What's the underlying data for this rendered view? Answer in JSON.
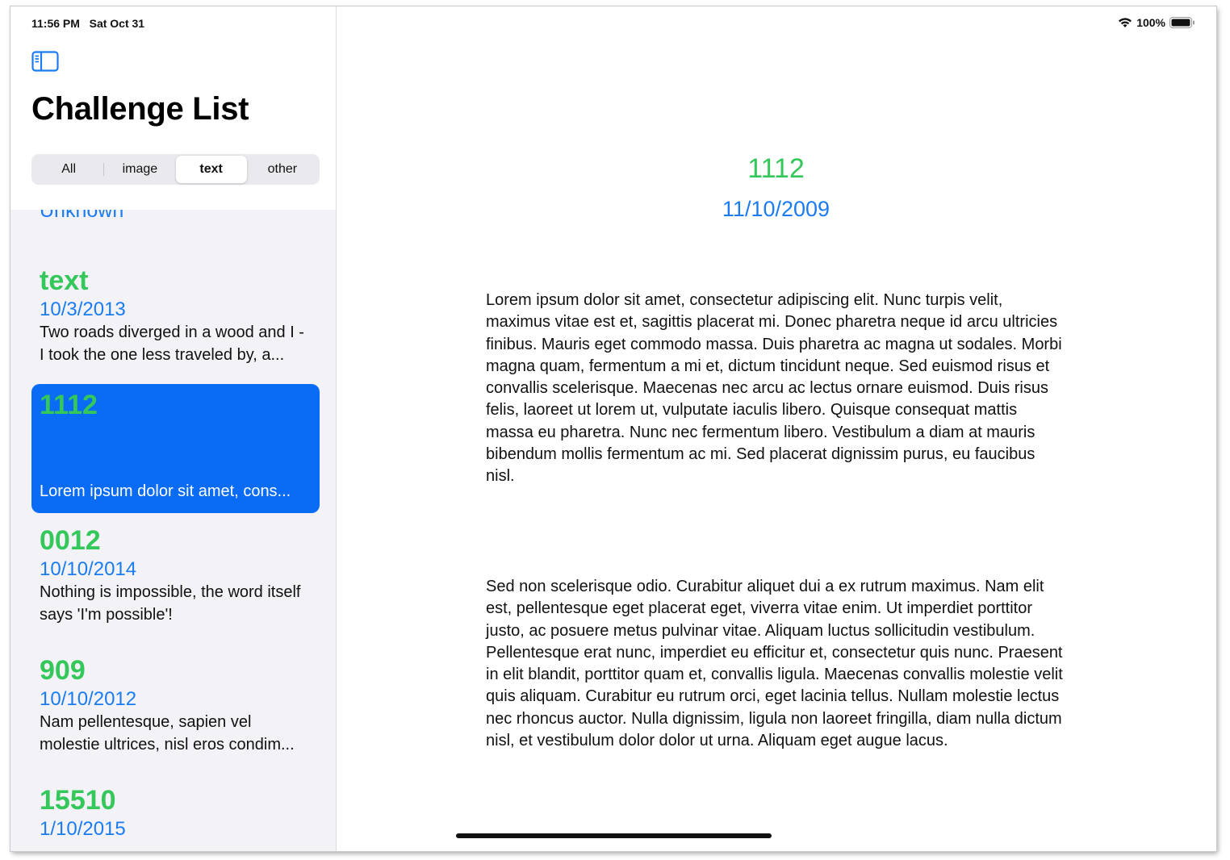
{
  "status": {
    "time": "11:56 PM",
    "date": "Sat Oct 31",
    "battery": "100%"
  },
  "sidebar": {
    "title": "Challenge List",
    "segments": [
      "All",
      "image",
      "text",
      "other"
    ],
    "selected_segment": "text",
    "partial_item_date": "Unknown",
    "items": [
      {
        "title": "text",
        "date": "10/3/2013",
        "preview": "Two roads diverged in a wood and I - I took the one less traveled by, a..."
      },
      {
        "title": "1112",
        "date": "",
        "preview": "Lorem ipsum dolor sit amet, cons..."
      },
      {
        "title": "0012",
        "date": "10/10/2014",
        "preview": "Nothing is impossible, the word itself says 'I'm possible'!"
      },
      {
        "title": "909",
        "date": "10/10/2012",
        "preview": "Nam pellentesque, sapien vel molestie ultrices, nisl eros condim..."
      },
      {
        "title": "15510",
        "date": "1/10/2015",
        "preview": ""
      }
    ]
  },
  "detail": {
    "number": "1112",
    "date": "11/10/2009",
    "paragraph1": "Lorem ipsum dolor sit amet, consectetur adipiscing elit. Nunc turpis velit, maximus vitae est et, sagittis placerat mi. Donec pharetra neque id arcu ultricies finibus. Mauris eget commodo massa. Duis pharetra ac magna ut sodales. Morbi magna quam, fermentum a mi et, dictum tincidunt neque. Sed euismod risus et convallis scelerisque. Maecenas nec arcu ac lectus ornare euismod. Duis risus felis, laoreet ut lorem ut, vulputate iaculis libero. Quisque consequat mattis massa eu pharetra. Nunc nec fermentum libero. Vestibulum a diam at mauris bibendum mollis fermentum ac mi. Sed placerat dignissim purus, eu faucibus nisl.",
    "paragraph2": "Sed non scelerisque odio. Curabitur aliquet dui a ex rutrum maximus. Nam elit est, pellentesque eget placerat eget, viverra vitae enim. Ut imperdiet porttitor justo, ac posuere metus pulvinar vitae. Aliquam luctus sollicitudin vestibulum. Pellentesque erat nunc, imperdiet eu efficitur et, consectetur quis nunc. Praesent in elit blandit, porttitor quam et, convallis ligula. Maecenas convallis molestie velit quis aliquam. Curabitur eu rutrum orci, eget lacinia tellus. Nullam molestie lectus nec rhoncus auctor. Nulla dignissim, ligula non laoreet fringilla, diam nulla dictum nisl, et vestibulum dolor dolor ut urna. Aliquam eget augue lacus."
  },
  "colors": {
    "accent_blue": "#1a7cf0",
    "selection_blue": "#0a6cf5",
    "title_green": "#34c759"
  }
}
